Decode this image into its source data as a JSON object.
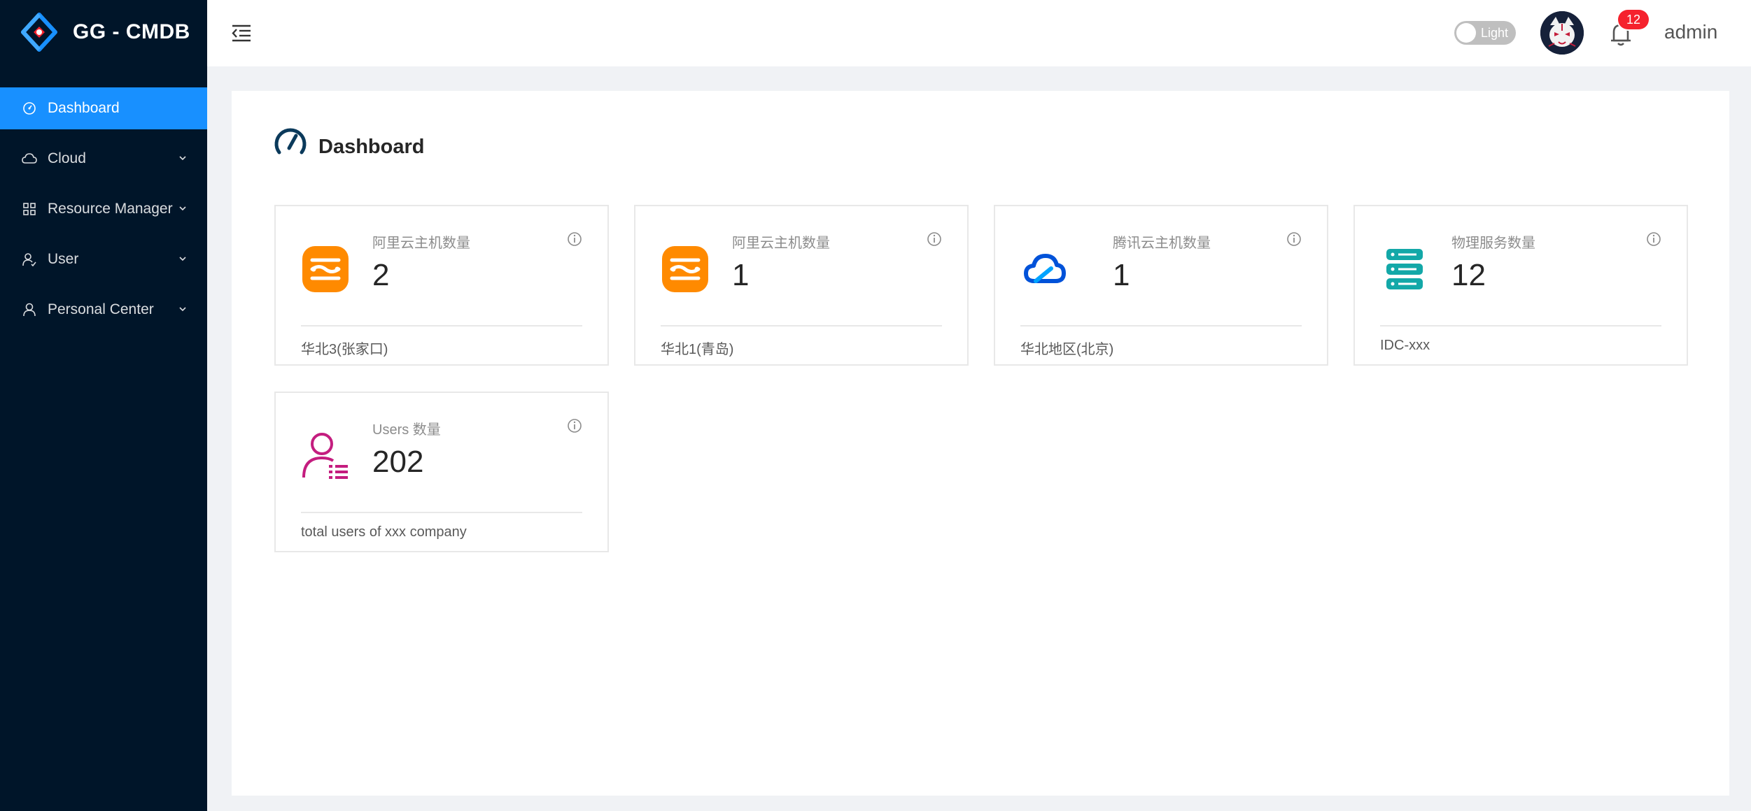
{
  "app": {
    "title": "GG - CMDB"
  },
  "sidebar": {
    "items": [
      {
        "label": "Dashboard",
        "icon": "dashboard-icon",
        "active": true
      },
      {
        "label": "Cloud",
        "icon": "cloud-icon",
        "expandable": true
      },
      {
        "label": "Resource Manager",
        "icon": "grid-icon",
        "expandable": true
      },
      {
        "label": "User",
        "icon": "user-icon",
        "expandable": true
      },
      {
        "label": "Personal Center",
        "icon": "person-icon",
        "expandable": true
      }
    ]
  },
  "header": {
    "theme_toggle_label": "Light",
    "notification_count": "12",
    "username": "admin"
  },
  "page": {
    "title": "Dashboard"
  },
  "cards": [
    {
      "title": "阿里云主机数量",
      "value": "2",
      "footer": "华北3(张家口)",
      "icon": "aliyun-icon"
    },
    {
      "title": "阿里云主机数量",
      "value": "1",
      "footer": "华北1(青岛)",
      "icon": "aliyun-icon"
    },
    {
      "title": "腾讯云主机数量",
      "value": "1",
      "footer": "华北地区(北京)",
      "icon": "tencent-cloud-icon"
    },
    {
      "title": "物理服务数量",
      "value": "12",
      "footer": "IDC-xxx",
      "icon": "server-icon"
    },
    {
      "title": "Users 数量",
      "value": "202",
      "footer": "total users of xxx company",
      "icon": "users-list-icon"
    }
  ],
  "colors": {
    "sidebar_bg": "#001529",
    "active_item": "#1890ff",
    "aliyun_orange": "#ff8a00",
    "tencent_blue": "#0052d9",
    "server_teal": "#13a8a8",
    "users_magenta": "#c41d7f",
    "badge_red": "#f5222d"
  }
}
